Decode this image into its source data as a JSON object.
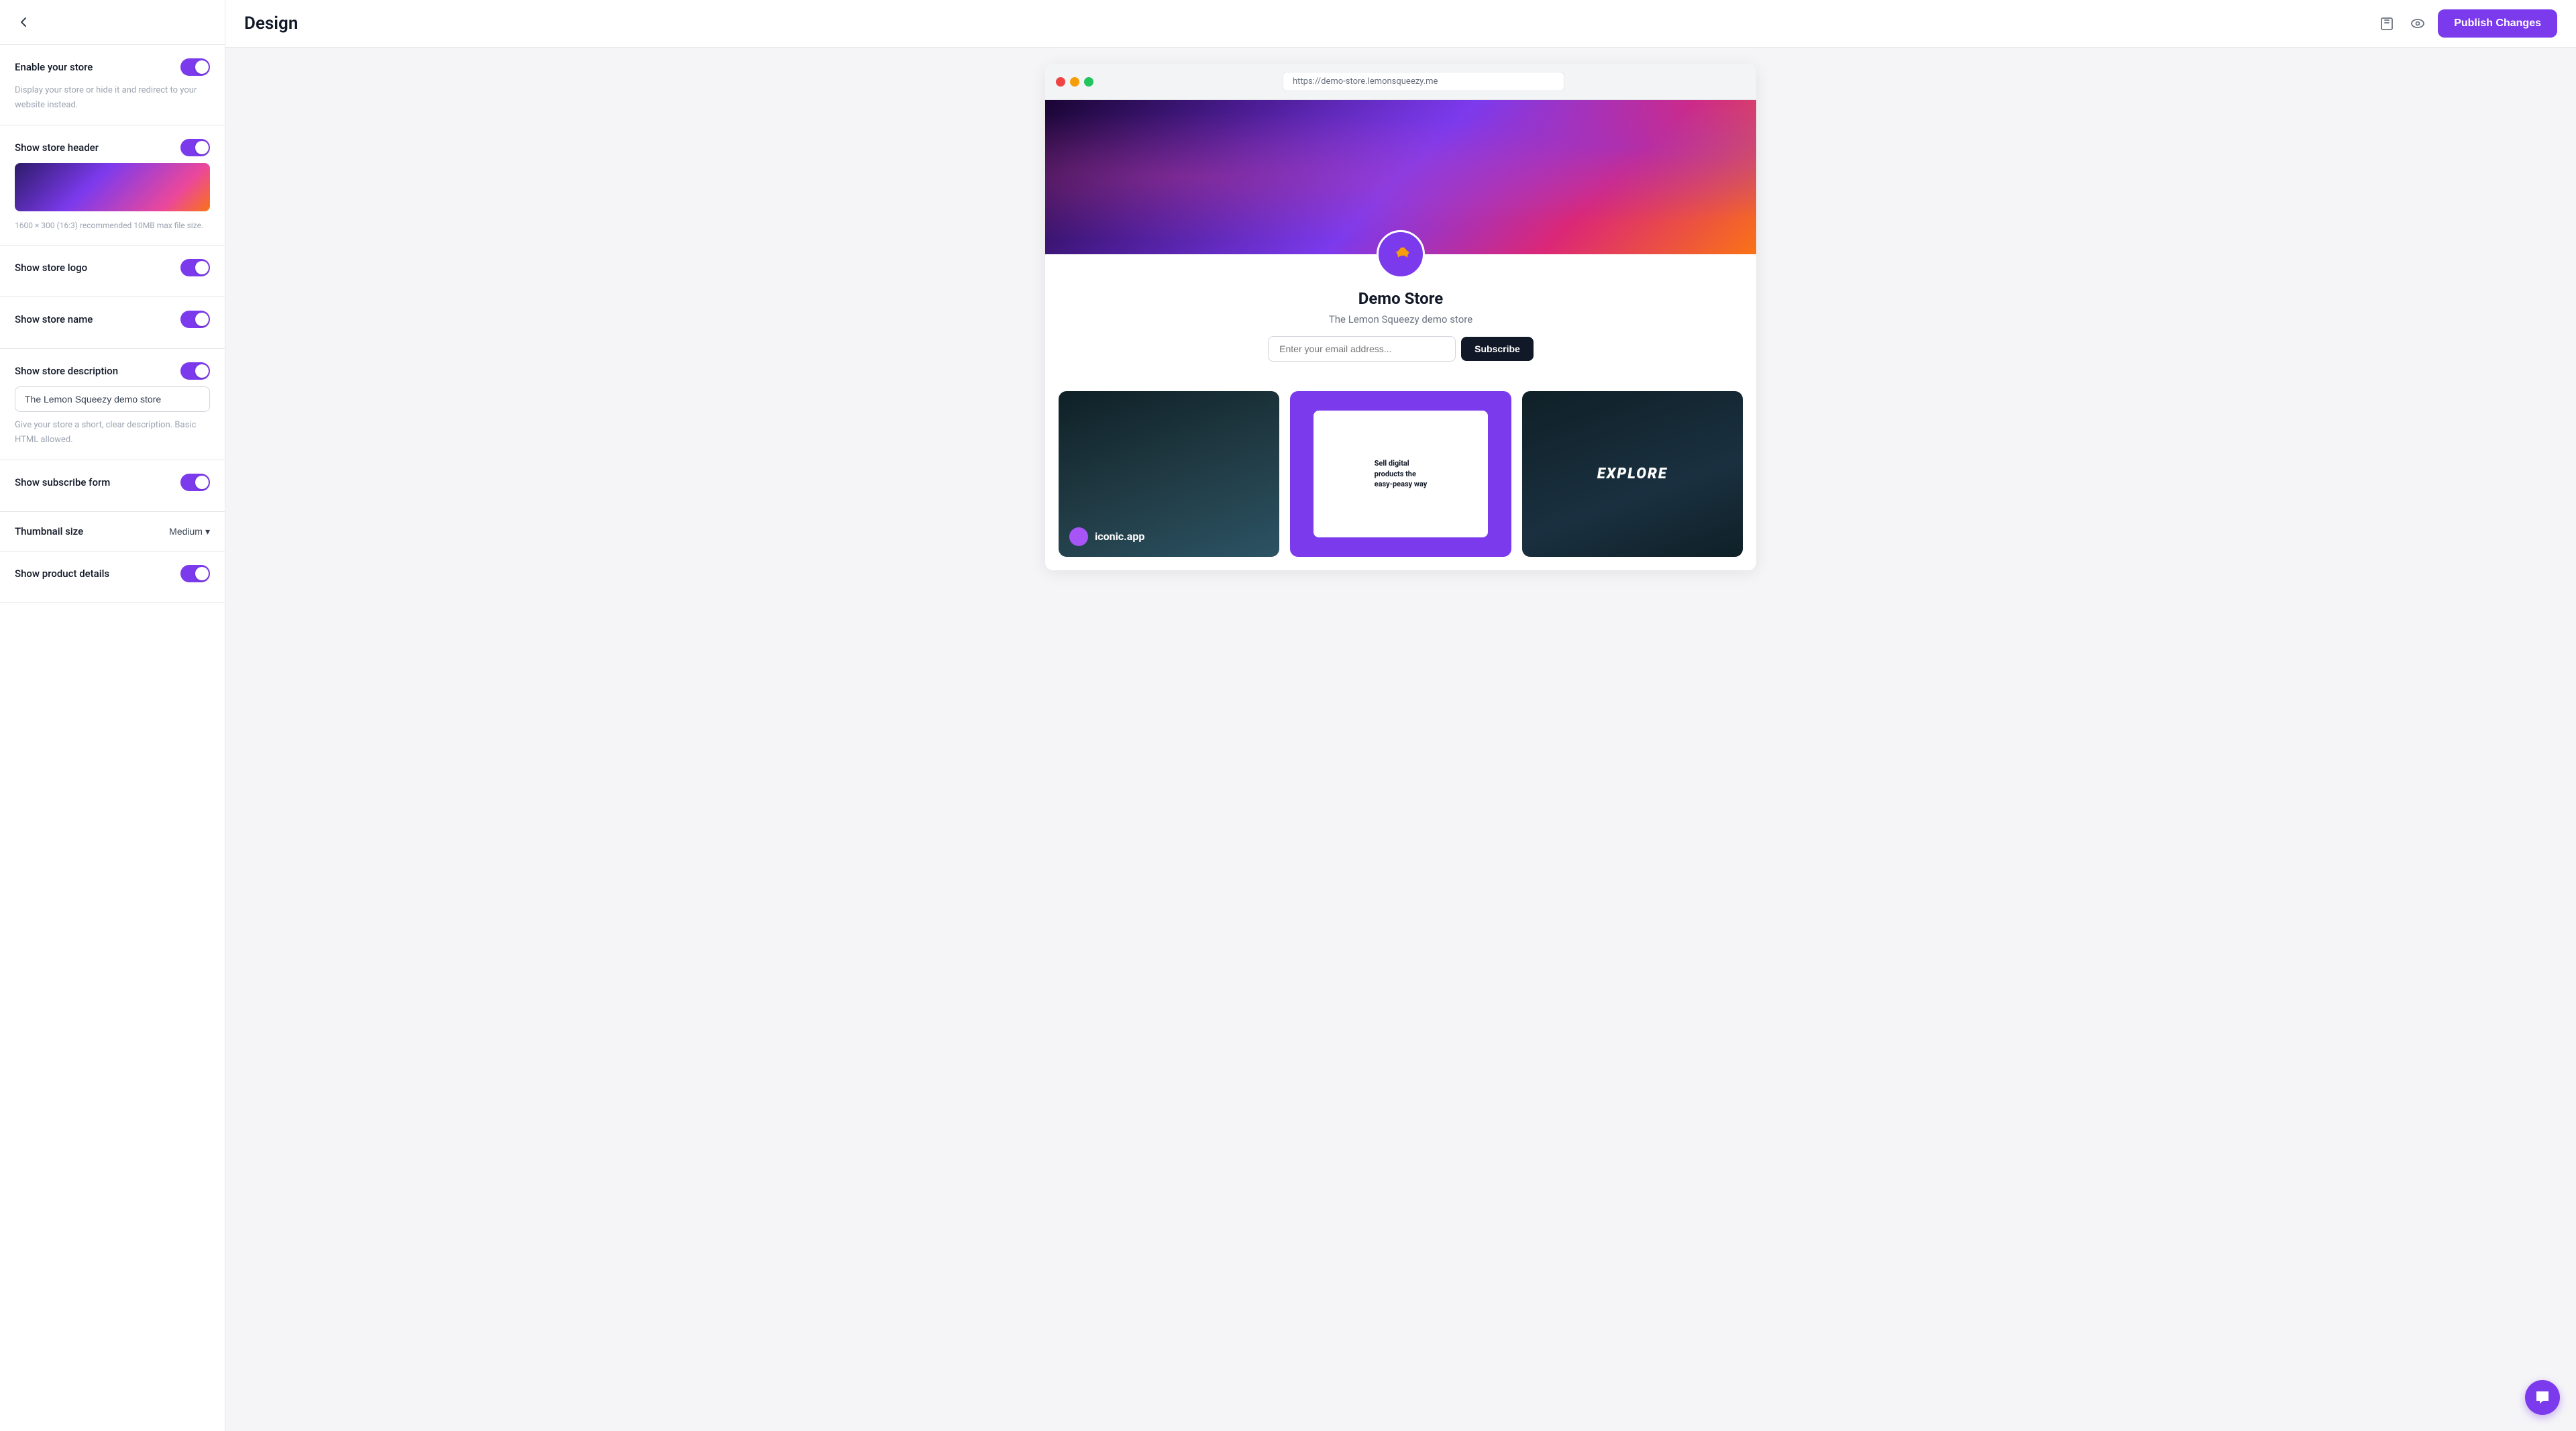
{
  "sidebar": {
    "back_label": "←",
    "sections": [
      {
        "id": "enable-store",
        "label": "Enable your store",
        "hint": "Display your store or hide it and redirect to your website instead.",
        "toggle": true,
        "toggle_on": true
      },
      {
        "id": "show-header",
        "label": "Show store header",
        "toggle": true,
        "toggle_on": true,
        "img_hint": "1600 × 300 (16:3) recommended\n10MB max file size."
      },
      {
        "id": "show-logo",
        "label": "Show store logo",
        "toggle": true,
        "toggle_on": true
      },
      {
        "id": "show-name",
        "label": "Show store name",
        "toggle": true,
        "toggle_on": true
      },
      {
        "id": "show-description",
        "label": "Show store description",
        "toggle": true,
        "toggle_on": true,
        "textarea_value": "The Lemon Squeezy demo store",
        "textarea_hint": "Give your store a short, clear description. Basic HTML allowed."
      },
      {
        "id": "show-subscribe",
        "label": "Show subscribe form",
        "toggle": true,
        "toggle_on": true
      },
      {
        "id": "thumbnail-size",
        "label": "Thumbnail size",
        "select_value": "Medium"
      },
      {
        "id": "show-product-details",
        "label": "Show product details",
        "toggle": true,
        "toggle_on": true
      }
    ]
  },
  "topbar": {
    "title": "Design",
    "publish_label": "Publish Changes"
  },
  "preview": {
    "url": "https://demo-store.lemonsqueezy.me",
    "store_name": "Demo Store",
    "store_description": "The Lemon Squeezy demo store",
    "email_placeholder": "Enter your email address...",
    "subscribe_label": "Subscribe",
    "products": [
      {
        "id": "iconic",
        "name": "iconic.app"
      },
      {
        "id": "lemon",
        "name": "Sell digital products"
      },
      {
        "id": "explore",
        "name": "EXPLORE"
      }
    ]
  },
  "icons": {
    "book": "📖",
    "eye": "👁",
    "chevron_down": "▾",
    "chat": "💬",
    "lemon_leaf": "🍋"
  }
}
